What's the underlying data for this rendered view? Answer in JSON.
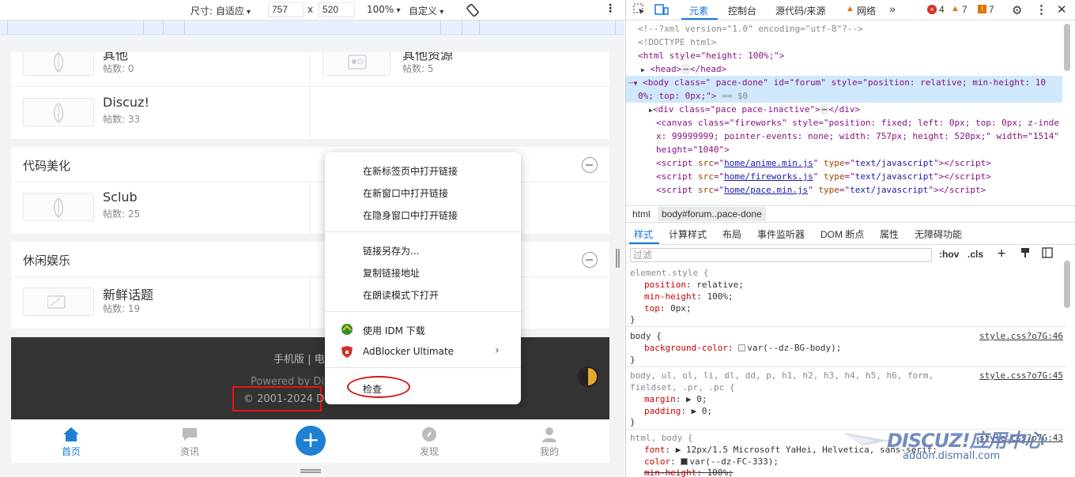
{
  "device_toolbar": {
    "dimensions_label": "尺寸: 自适应",
    "width": "757",
    "times": "x",
    "height": "520",
    "zoom": "100%",
    "throttle": "自定义"
  },
  "forum": {
    "rows_top": [
      {
        "name": "其他",
        "count": "帖数: 0"
      },
      {
        "name": "其他资源",
        "count": "帖数: 5"
      }
    ],
    "discuz": {
      "name": "Discuz!",
      "count": "帖数: 33"
    },
    "sections": [
      {
        "title": "代码美化",
        "forum": {
          "name": "Sclub",
          "count": "帖数: 25"
        }
      },
      {
        "title": "休闲娱乐",
        "forum": {
          "name": "新鲜话题",
          "count": "帖数: 19"
        }
      }
    ],
    "footer": {
      "links": "手机版 | 电",
      "powered": "Powered by Dis",
      "copyright": "© 2001-2024 D"
    },
    "tabbar": {
      "home": "首页",
      "news": "资讯",
      "discover": "发现",
      "mine": "我的"
    }
  },
  "context_menu": {
    "items": [
      "在新标签页中打开链接",
      "在新窗口中打开链接",
      "在隐身窗口中打开链接",
      "链接另存为...",
      "复制链接地址",
      "在朗读模式下打开",
      "使用 IDM 下载",
      "AdBlocker Ultimate",
      "检查"
    ]
  },
  "devtools": {
    "tabs": [
      "元素",
      "控制台",
      "源代码/来源",
      "网络"
    ],
    "badges": {
      "errors": "4",
      "warnings": "7",
      "issues": "7"
    },
    "dom": {
      "xml": "<!--?xml version=\"1.0\" encoding=\"utf-8\"?-->",
      "doctype": "<!DOCTYPE html>",
      "html_open": "<html style=\"height: 100%;\">",
      "head": "<head>",
      "head_close": "</head>",
      "body_line1": "<body class=\"  pace-done\" id=\"forum\" style=\"position: relative; min-height: 10",
      "body_line2": "0%; top: 0px;\">",
      "dollar0": "== $0",
      "pace_div": "<div class=\"pace  pace-inactive\">",
      "pace_div_close": "</div>",
      "canvas1": "<canvas class=\"fireworks\" style=\"position: fixed; left: 0px; top: 0px; z-inde",
      "canvas2": "x: 99999999; pointer-events: none; width: 757px; height: 520px;\" width=\"1514\"",
      "canvas3": "height=\"1040\">",
      "script1_src": "home/anime.min.js",
      "script2_src": "home/fireworks.js",
      "script3_src": "home/pace.min.js"
    },
    "breadcrumbs": {
      "html": "html",
      "body": "body#forum..pace-done"
    },
    "subtabs": [
      "样式",
      "计算样式",
      "布局",
      "事件监听器",
      "DOM 断点",
      "属性",
      "无障碍功能"
    ],
    "filter_placeholder": "过滤",
    "hov": ":hov",
    "cls": ".cls",
    "styles": {
      "element_style": "element.style {",
      "pos": "position",
      "pos_v": "relative;",
      "minh": "min-height",
      "minh_v": "100%;",
      "top": "top",
      "top_v": "0px;",
      "close": "}",
      "body_sel": "body {",
      "body_src": "style.css?o7G:46",
      "bg": "background-color",
      "bg_v": "var(--dz-BG-body);",
      "reset_sel": "body, ul, ol, li, dl, dd, p, h1, h2, h3, h4, h5, h6, form,",
      "reset_sel2": "fieldset, .pr, .pc {",
      "reset_src": "style.css?o7G:45",
      "margin": "margin",
      "margin_v": "0;",
      "padding": "padding",
      "padding_v": "0;",
      "htmlbody_sel": "html, body {",
      "htmlbody_src": "style.css?o7G:43",
      "font": "font",
      "font_v": "12px/1.5 Microsoft YaHei, Helvetica, sans-serif;",
      "color": "color",
      "color_v": "var(--dz-FC-333);",
      "minh2": "min-height",
      "minh2_v": "100%;"
    },
    "watermark": {
      "brand": "DISCUZ!应用中心",
      "url": "addon.dismall.com"
    }
  }
}
